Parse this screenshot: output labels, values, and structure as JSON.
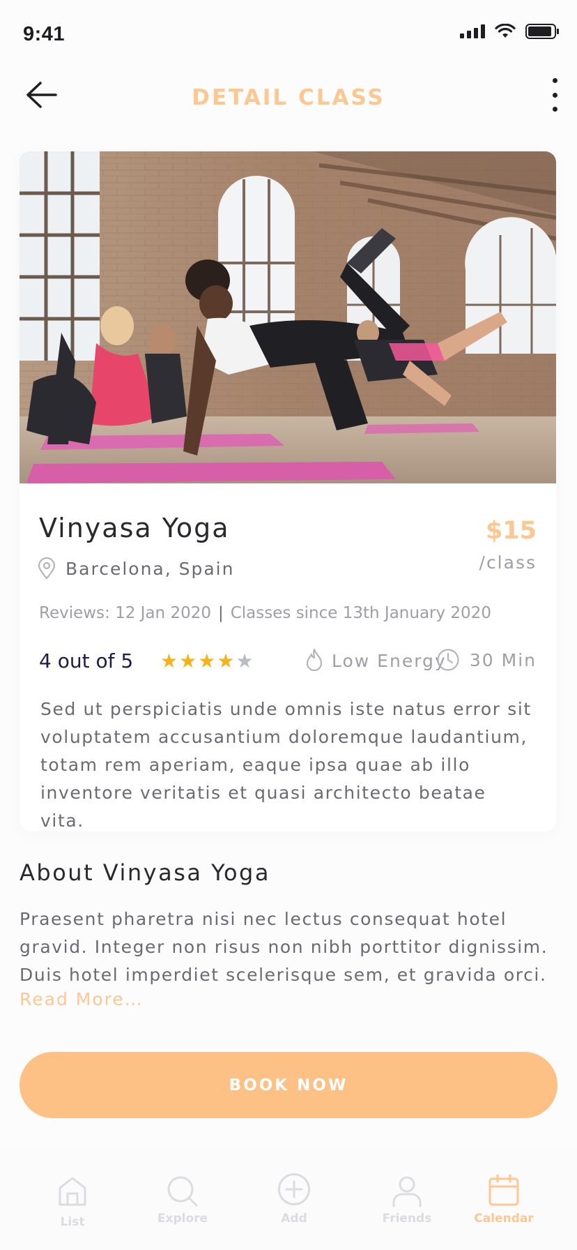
{
  "status_bar": {
    "time": "9:41"
  },
  "header": {
    "title": "DETAIL CLASS",
    "back_icon": "arrow-left-icon",
    "more_icon": "more-vertical-icon"
  },
  "class": {
    "name": "Vinyasa Yoga",
    "price": "$15",
    "price_unit": "/class",
    "location": "Barcelona, Spain",
    "reviews": "Reviews: 12 Jan 2020",
    "separator": "|",
    "classes_since": "Classes since 13th January 2020",
    "rating_text": "4 out of 5",
    "rating_value": 4,
    "rating_max": 5,
    "energy": "Low Energy",
    "duration": "30 Min",
    "description": "Sed ut perspiciatis unde omnis iste natus error sit voluptatem accusantium doloremque laudantium, totam rem aperiam, eaque ipsa quae ab illo inventore veritatis et quasi architecto beatae vita."
  },
  "about": {
    "title": "About Vinyasa Yoga",
    "text": "Praesent pharetra nisi nec lectus consequat hotel gravid. Integer non risus non nibh porttitor dignissim. Duis hotel imperdiet scelerisque sem, et gravida orci.",
    "read_more": "Read More…"
  },
  "book_button": "BOOK NOW",
  "tabs": [
    {
      "label": "List",
      "icon": "home-icon",
      "active": false
    },
    {
      "label": "Explore",
      "icon": "search-icon",
      "active": false
    },
    {
      "label": "Add",
      "icon": "plus-circle-icon",
      "active": false
    },
    {
      "label": "Friends",
      "icon": "user-icon",
      "active": false
    },
    {
      "label": "Calendar",
      "icon": "calendar-icon",
      "active": true
    }
  ],
  "colors": {
    "accent": "#fcc791",
    "button": "#fdc186",
    "star_filled": "#f7b21a",
    "star_empty": "#b8bac4",
    "text_dark": "#28282e",
    "text_muted": "#9e9ea6",
    "rating_text": "#1b1b4a"
  }
}
